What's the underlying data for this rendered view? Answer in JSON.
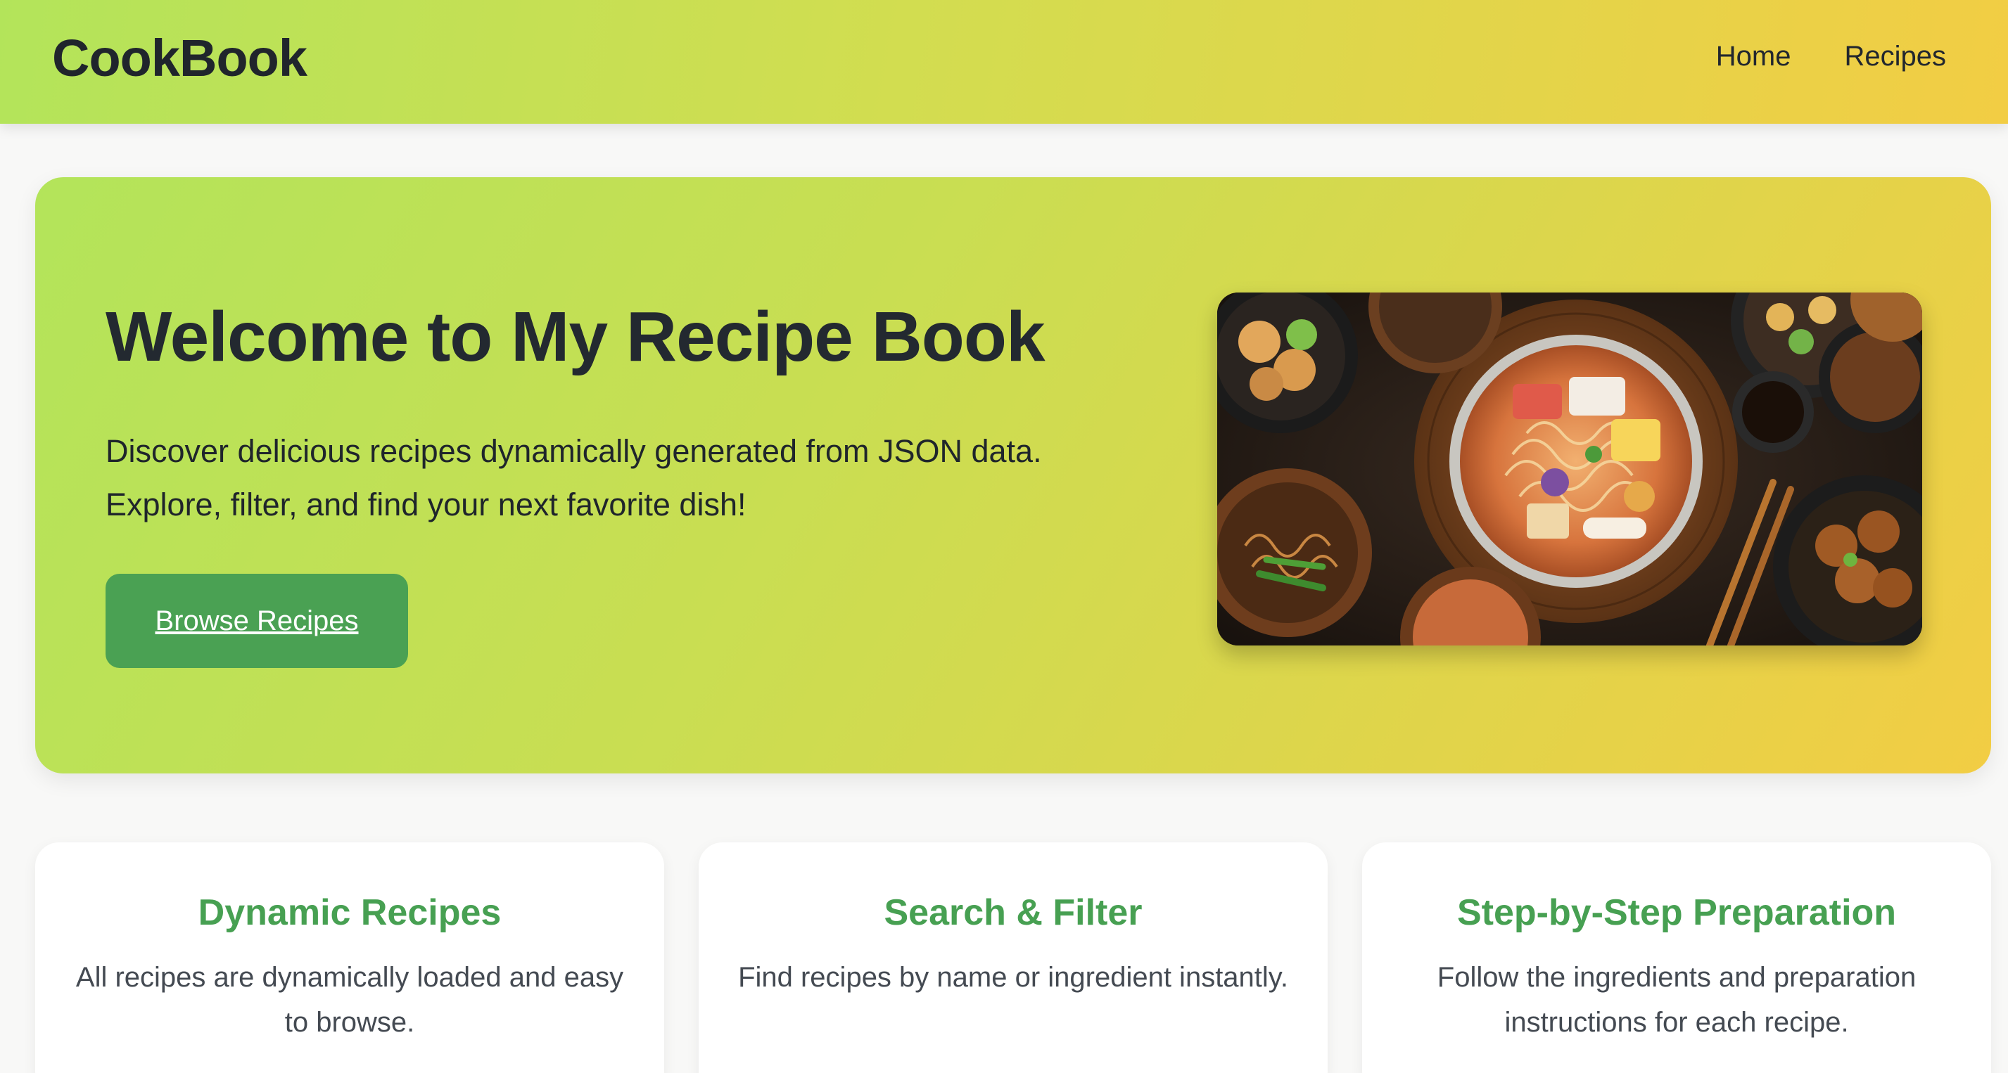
{
  "header": {
    "brand": "CookBook",
    "nav": [
      {
        "label": "Home"
      },
      {
        "label": "Recipes"
      }
    ]
  },
  "hero": {
    "title": "Welcome to My Recipe Book",
    "description_line1": "Discover delicious recipes dynamically generated from JSON data.",
    "description_line2": "Explore, filter, and find your next favorite dish!",
    "button_label": "Browse Recipes"
  },
  "features": [
    {
      "title": "Dynamic Recipes",
      "text": "All recipes are dynamically loaded and easy to browse."
    },
    {
      "title": "Search & Filter",
      "text": "Find recipes by name or ingredient instantly."
    },
    {
      "title": "Step-by-Step Preparation",
      "text": "Follow the ingredients and preparation instructions for each recipe."
    }
  ],
  "colors": {
    "accent_green": "#4aa153",
    "gradient_start": "#b3e45a",
    "gradient_end": "#f2cd44",
    "title_dark": "#232930"
  }
}
